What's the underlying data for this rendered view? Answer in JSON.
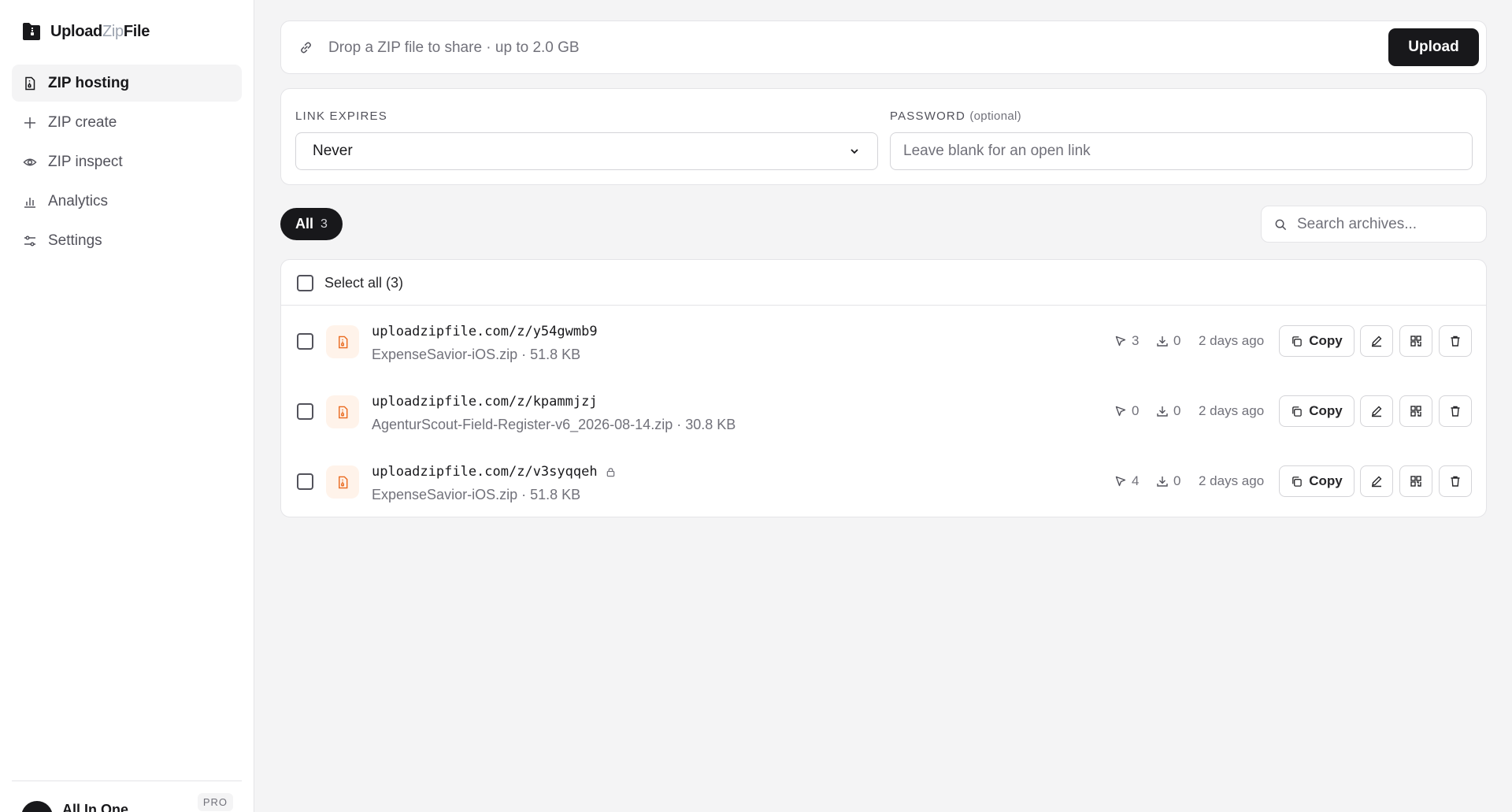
{
  "brand": {
    "name_part1": "Upload",
    "name_part2": "Zip",
    "name_part3": "File",
    "logo_icon": "folder-zip-icon"
  },
  "sidebar": {
    "items": [
      {
        "label": "ZIP hosting",
        "icon": "file-zip-icon",
        "active": true
      },
      {
        "label": "ZIP create",
        "icon": "plus-icon",
        "active": false
      },
      {
        "label": "ZIP inspect",
        "icon": "eye-icon",
        "active": false
      },
      {
        "label": "Analytics",
        "icon": "bar-chart-icon",
        "active": false
      },
      {
        "label": "Settings",
        "icon": "sliders-icon",
        "active": false
      }
    ],
    "user": {
      "name": "All In One",
      "plan": "PRO"
    }
  },
  "upload": {
    "drop_text": "Drop a ZIP file to share · up to 2.0 GB",
    "button_label": "Upload"
  },
  "options": {
    "expires_label": "LINK EXPIRES",
    "expires_value": "Never",
    "password_label": "PASSWORD",
    "password_optional": "(optional)",
    "password_placeholder": "Leave blank for an open link"
  },
  "filter": {
    "label": "All",
    "count": "3"
  },
  "search": {
    "placeholder": "Search archives..."
  },
  "list": {
    "select_all_label": "Select all (3)",
    "rows": [
      {
        "url": "uploadzipfile.com/z/y54gwmb9",
        "locked": false,
        "meta": "ExpenseSavior-iOS.zip · 51.8 KB",
        "clicks": "3",
        "downloads": "0",
        "ago": "2 days ago",
        "copy_label": "Copy"
      },
      {
        "url": "uploadzipfile.com/z/kpammjzj",
        "locked": false,
        "meta": "AgenturScout-Field-Register-v6_2026-08-14.zip · 30.8 KB",
        "clicks": "0",
        "downloads": "0",
        "ago": "2 days ago",
        "copy_label": "Copy"
      },
      {
        "url": "uploadzipfile.com/z/v3syqqeh",
        "locked": true,
        "meta": "ExpenseSavior-iOS.zip · 51.8 KB",
        "clicks": "4",
        "downloads": "0",
        "ago": "2 days ago",
        "copy_label": "Copy"
      }
    ]
  },
  "colors": {
    "accent": "#18181b",
    "file_icon": "#ea6a1f",
    "file_icon_bg": "#fff3ea"
  }
}
